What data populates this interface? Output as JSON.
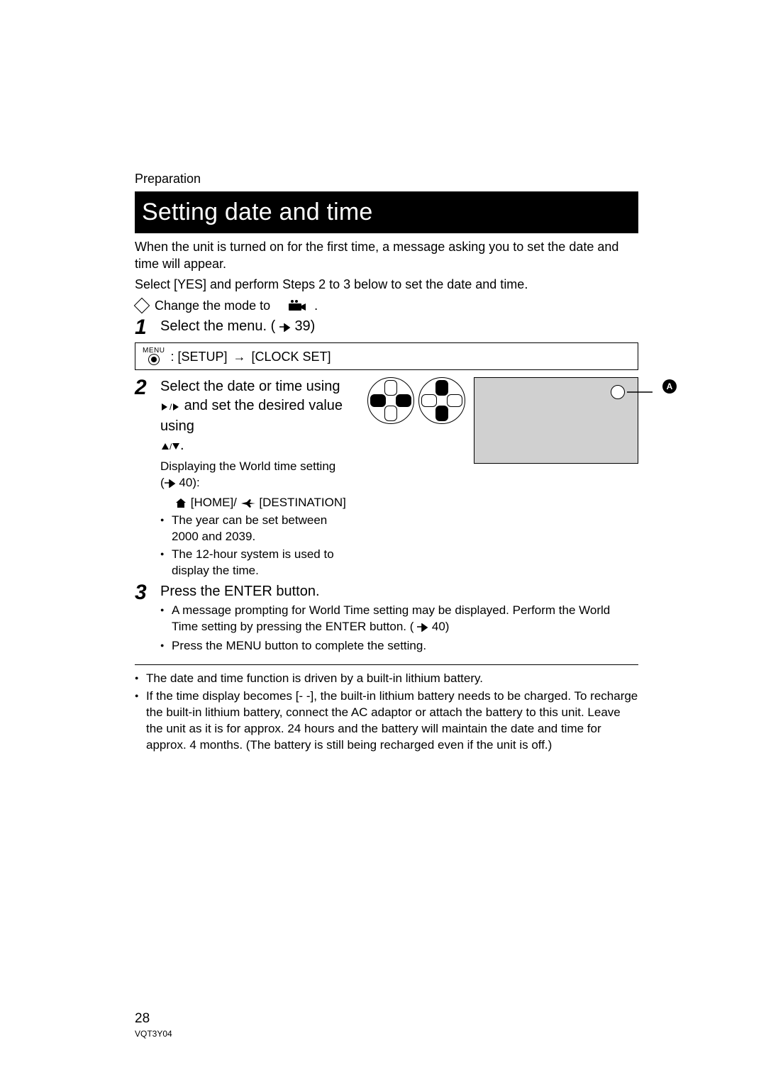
{
  "section_label": "Preparation",
  "title": "Setting date and time",
  "intro1": "When the unit is turned on for the first time, a message asking you to set the date and time will appear.",
  "intro2": "Select [YES] and perform Steps 2 to 3 below to set the date and time.",
  "mode_text": "Change the mode to",
  "mode_suffix": ".",
  "step1": {
    "num": "1",
    "text_a": "Select the menu. (",
    "ref": "39)",
    "menu_setup": ": [SETUP]",
    "menu_arrow": "→",
    "menu_clock": "[CLOCK SET]"
  },
  "step2": {
    "num": "2",
    "line_a": "Select the date or time using ",
    "line_b": " and set the desired value using ",
    "line_c": ".",
    "sub1_a": "Displaying the World time setting",
    "sub1_b": "40):",
    "home": "[HOME]/",
    "dest": "[DESTINATION]",
    "b1": "The year can be set between 2000 and 2039.",
    "b2": "The 12-hour system is used to display the time."
  },
  "step3": {
    "num": "3",
    "text": "Press the ENTER button.",
    "b1_a": "A message prompting for World Time setting may be displayed. Perform the World Time setting by pressing the ENTER button. (",
    "b1_b": "40)",
    "b2": "Press the MENU button to complete the setting."
  },
  "notes": {
    "n1": "The date and time function is driven by a built-in lithium battery.",
    "n2": "If the time display becomes [- -], the built-in lithium battery needs to be charged. To recharge the built-in lithium battery, connect the AC adaptor or attach the battery to this unit. Leave the unit as it is for approx. 24 hours and the battery will maintain the date and time for approx. 4 months. (The battery is still being recharged even if the unit is off.)"
  },
  "callout_label": "A",
  "page_number": "28",
  "doc_code": "VQT3Y04",
  "menu_word": "MENU"
}
